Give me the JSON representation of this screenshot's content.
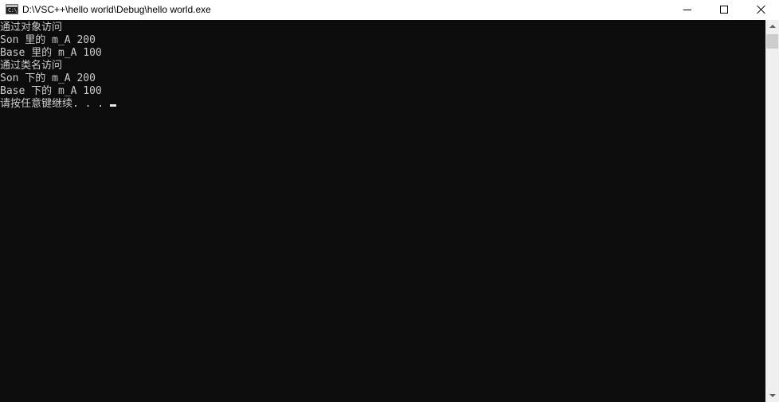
{
  "window": {
    "title": "D:\\VSC++\\hello world\\Debug\\hello world.exe",
    "icon_label": "C:\\",
    "controls": {
      "minimize": "minimize-icon",
      "maximize": "maximize-icon",
      "close": "close-icon"
    }
  },
  "console": {
    "lines": [
      "通过对象访问",
      "Son 里的 m_A 200",
      "Base 里的 m_A 100",
      "通过类名访问",
      "Son 下的 m_A 200",
      "Base 下的 m_A 100",
      "请按任意键继续. . ."
    ],
    "text_color": "#cccccc",
    "background_color": "#0c0c0c"
  },
  "scrollbar": {
    "up_icon": "scroll-up-arrow-icon",
    "down_icon": "scroll-down-arrow-icon"
  }
}
